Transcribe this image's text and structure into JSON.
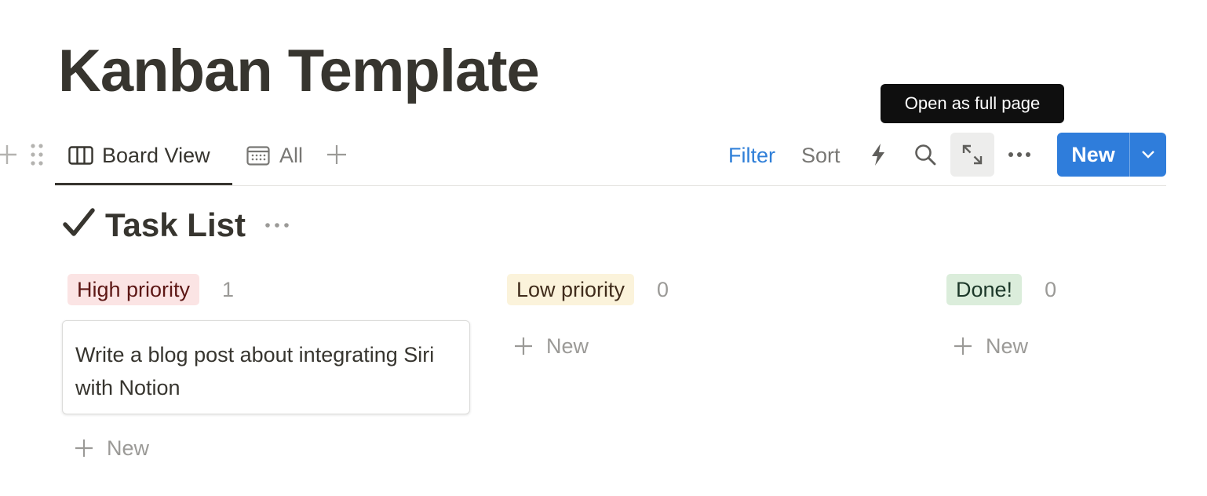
{
  "page": {
    "title": "Kanban Template"
  },
  "tooltip": {
    "text": "Open as full page"
  },
  "view_bar": {
    "tabs": [
      {
        "label": "Board View",
        "icon": "board-icon",
        "active": true
      },
      {
        "label": "All",
        "icon": "calendar-icon",
        "active": false
      }
    ],
    "filter_label": "Filter",
    "sort_label": "Sort",
    "new_label": "New"
  },
  "section": {
    "title": "Task List"
  },
  "columns": [
    {
      "name": "High priority",
      "count": "1",
      "color": "#fbe4e4",
      "cards": [
        {
          "title": "Write a blog post about integrating Siri with Notion"
        }
      ],
      "new_label": "New"
    },
    {
      "name": "Low priority",
      "count": "0",
      "color": "#fbf3db",
      "cards": [],
      "new_label": "New"
    },
    {
      "name": "Done!",
      "count": "0",
      "color": "#dbeddb",
      "cards": [],
      "new_label": "New"
    }
  ],
  "colors": {
    "accent": "#2f7ddb",
    "filter_text": "#2f7fd8",
    "text_primary": "#37352f",
    "text_muted": "#9b9a97"
  }
}
